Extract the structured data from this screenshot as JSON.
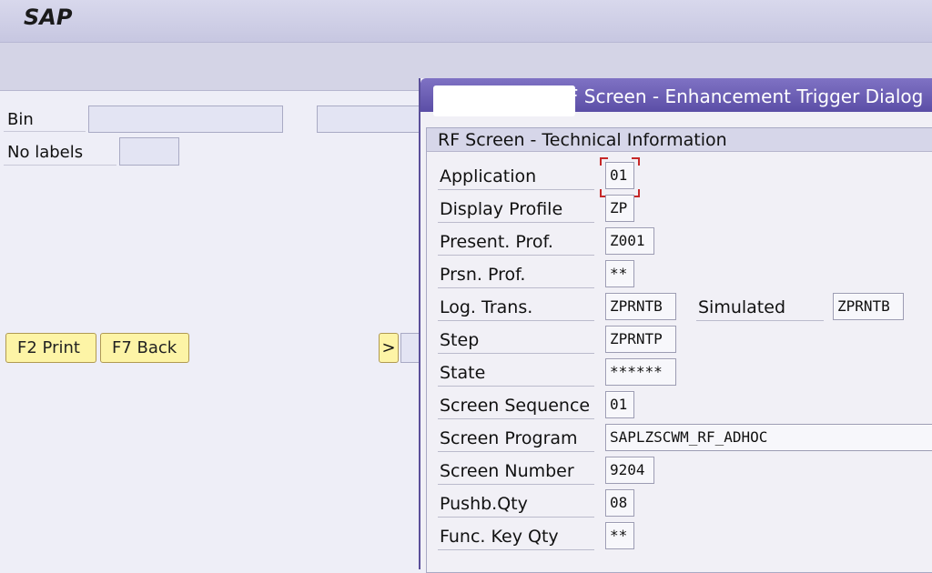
{
  "app": {
    "title": "SAP"
  },
  "background": {
    "bin_label": "Bin",
    "no_labels_label": "No labels",
    "f2_label": "F2 Print",
    "f7_label": "F7 Back",
    "arrow_label": ">"
  },
  "dialog": {
    "title": "RF Screen - Enhancement Trigger Dialog",
    "group_title": "RF Screen - Technical Information",
    "fields": [
      {
        "label": "Application",
        "value": "01"
      },
      {
        "label": "Display Profile",
        "value": "ZP"
      },
      {
        "label": "Present. Prof.",
        "value": "Z001"
      },
      {
        "label": "Prsn. Prof.",
        "value": "**"
      },
      {
        "label": "Log. Trans.",
        "value": "ZPRNTB"
      },
      {
        "label": "Step",
        "value": "ZPRNTP"
      },
      {
        "label": "State",
        "value": "******"
      },
      {
        "label": "Screen Sequence",
        "value": "01"
      },
      {
        "label": "Screen Program",
        "value": "SAPLZSCWM_RF_ADHOC"
      },
      {
        "label": "Screen Number",
        "value": "9204"
      },
      {
        "label": "Pushb.Qty",
        "value": "08"
      },
      {
        "label": "Func. Key Qty",
        "value": "**"
      }
    ],
    "simulated": {
      "label": "Simulated",
      "value": "ZPRNTB"
    }
  }
}
